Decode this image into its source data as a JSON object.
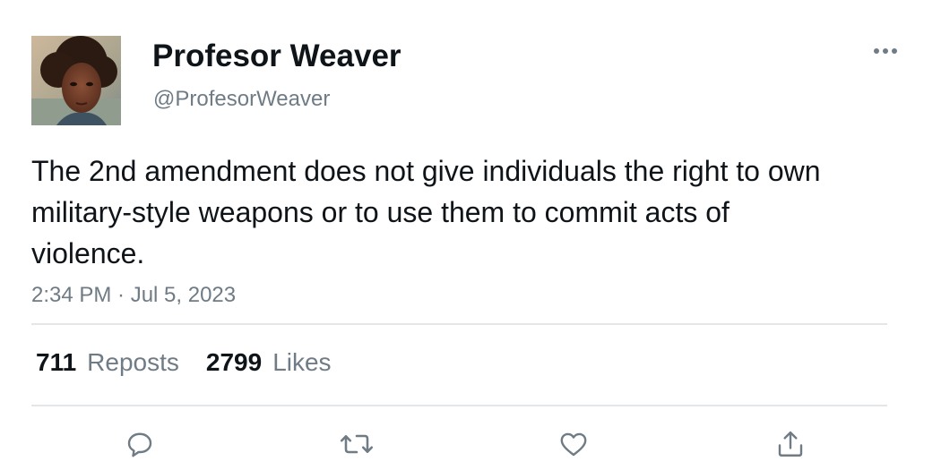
{
  "author": {
    "display_name": "Profesor Weaver",
    "handle": "@ProfesorWeaver",
    "avatar_icon": "profile-photo"
  },
  "tweet": {
    "text": "The 2nd amendment does not give individuals the right to own military-style weapons or to use them to commit acts of violence.",
    "timestamp": "2:34 PM · Jul 5, 2023"
  },
  "stats": {
    "reposts_count": "711",
    "reposts_label": "Reposts",
    "likes_count": "2799",
    "likes_label": "Likes"
  },
  "actions": [
    {
      "icon": "reply-icon"
    },
    {
      "icon": "repost-icon"
    },
    {
      "icon": "like-icon"
    },
    {
      "icon": "share-icon"
    }
  ],
  "colors": {
    "text_primary": "#0f1419",
    "text_secondary": "#6f7b85",
    "divider": "#e4e7ea"
  }
}
